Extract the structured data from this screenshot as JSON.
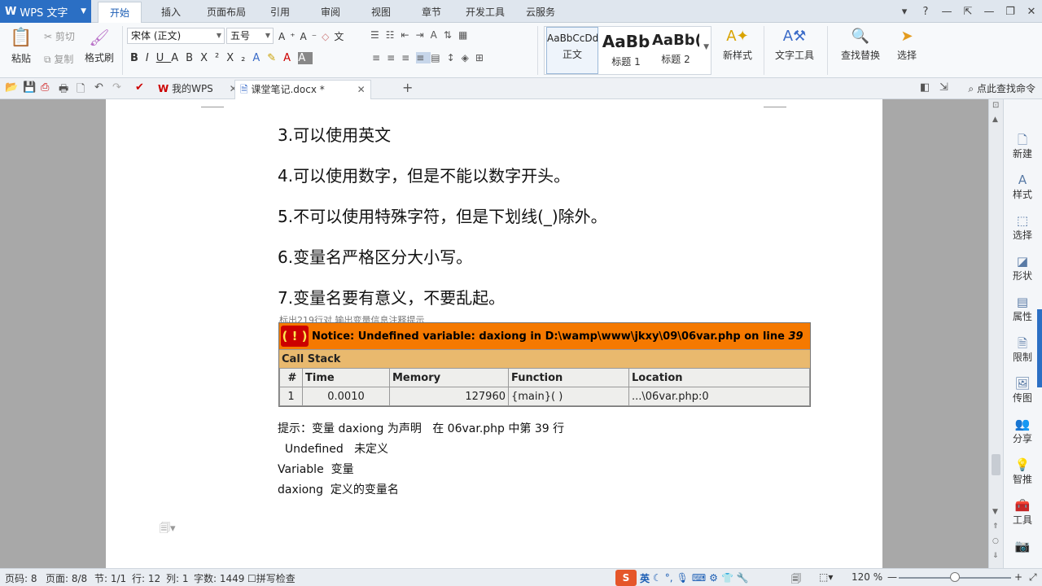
{
  "app": {
    "title": "WPS 文字"
  },
  "menu": {
    "tabs": [
      "开始",
      "插入",
      "页面布局",
      "引用",
      "审阅",
      "视图",
      "章节",
      "开发工具",
      "云服务"
    ],
    "active": "开始"
  },
  "window_controls": [
    "▾",
    "?",
    "—",
    "⇱",
    "—",
    "❐",
    "✕"
  ],
  "ribbon": {
    "paste": "粘贴",
    "cut": "剪切",
    "copy": "复制",
    "format_painter": "格式刷",
    "font_name": "宋体 (正文)",
    "font_size": "五号",
    "styles": [
      {
        "sample": "AaBbCcDd",
        "name": "正文"
      },
      {
        "sample": "AaBb",
        "name": "标题 1"
      },
      {
        "sample": "AaBb(",
        "name": "标题 2"
      }
    ],
    "new_style": "新样式",
    "text_tools": "文字工具",
    "find_replace": "查找替换",
    "select": "选择"
  },
  "tabs": {
    "home": "我的WPS",
    "document": "课堂笔记.docx *",
    "command_search": "点此查找命令"
  },
  "document": {
    "lines": [
      "3.可以使用英文",
      "4.可以使用数字，但是不能以数字开头。",
      "5.不可以使用特殊字符，但是下划线(_)除外。",
      "6.变量名严格区分大小写。",
      "7.变量名要有意义，不要乱起。"
    ],
    "error_box": {
      "cut_text": "标出219行对 输出变量信息注释提示",
      "notice": "Notice: Undefined variable: daxiong in D:\\wamp\\www\\jkxy\\09\\06var.php on line",
      "line_no": "39",
      "call_stack": "Call Stack",
      "headers": [
        "#",
        "Time",
        "Memory",
        "Function",
        "Location"
      ],
      "row": [
        "1",
        "0.0010",
        "127960",
        "{main}( )",
        "...\\06var.php:0"
      ]
    },
    "notes": [
      "提示：变量 daxiong 为声明   在 06var.php 中第 39 行",
      "  Undefined   未定义",
      "Variable  变量",
      "daxiong  定义的变量名"
    ]
  },
  "side_panel": [
    "新建",
    "样式",
    "选择",
    "形状",
    "属性",
    "限制",
    "传图",
    "分享",
    "智推",
    "工具"
  ],
  "status": {
    "page_code": "页码: 8",
    "page": "页面: 8/8",
    "section": "节: 1/1",
    "row": "行: 12",
    "col": "列: 1",
    "word_count": "字数: 1449",
    "spell": "拼写检查",
    "ime_lang": "英",
    "zoom": "120 %",
    "zoom_level": 0.5
  },
  "colors": {
    "accent": "#2b6fc4",
    "notice_bg": "#f57900",
    "callstack_bg": "#e9b96e"
  }
}
